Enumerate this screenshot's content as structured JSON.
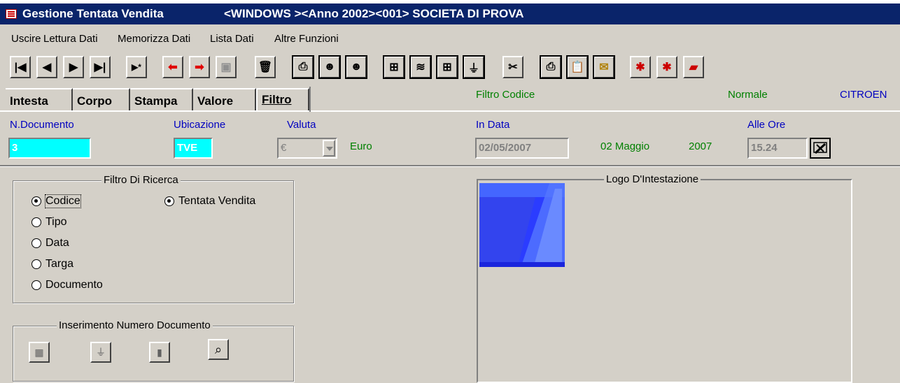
{
  "window": {
    "title": "Gestione Tentata Vendita",
    "title_info": "<WINDOWS    ><Anno 2002><001> SOCIETA DI PROVA"
  },
  "menu": [
    "Uscire",
    "Lettura Dati",
    "Memorizza Dati",
    "Lista Dati",
    "Altre Funzioni"
  ],
  "toolbar": {
    "icons": [
      "first-record-icon",
      "prev-record-icon",
      "next-record-icon",
      "last-record-icon",
      "new-record-icon",
      "back-arrow-icon",
      "forward-arrow-icon",
      "save-icon",
      "delete-icon",
      "print-icon",
      "face-left-icon",
      "face-right-icon",
      "record-find-icon",
      "stack-icon",
      "record-find-2-icon",
      "filter-icon",
      "cut-icon",
      "print-2-icon",
      "paste-icon",
      "envelope-icon",
      "note-icon",
      "note-2-icon",
      "book-icon"
    ]
  },
  "tabs": [
    "Intesta",
    "Corpo",
    "Stampa",
    "Valore",
    "Filtro"
  ],
  "status": {
    "filter": "Filtro Codice",
    "mode": "Normale",
    "brand": "CITROEN"
  },
  "header": {
    "doc_label": "N.Documento",
    "doc_value": "3",
    "location_label": "Ubicazione",
    "location_value": "TVE",
    "currency_label": "Valuta",
    "currency_value": "€",
    "currency_name": "Euro",
    "date_label": "In Data",
    "date_value": "02/05/2007",
    "date_text_day": "02 Maggio",
    "date_text_year": "2007",
    "time_label": "Alle Ore",
    "time_value": "15.24"
  },
  "filter_group": {
    "legend": "Filtro Di Ricerca",
    "options": [
      "Codice",
      "Tipo",
      "Data",
      "Targa",
      "Documento"
    ],
    "selected": "Codice",
    "type_option": "Tentata Vendita"
  },
  "insert_group": {
    "legend": "Inserimento Numero Documento"
  },
  "logo_group": {
    "legend": "Logo D'Intestazione"
  },
  "colors": {
    "titlebar": "#0a246a",
    "cyan_field": "#00ffff",
    "green_text": "#008000",
    "blue_text": "#0000c0",
    "logo_blue": "#3355ff"
  }
}
